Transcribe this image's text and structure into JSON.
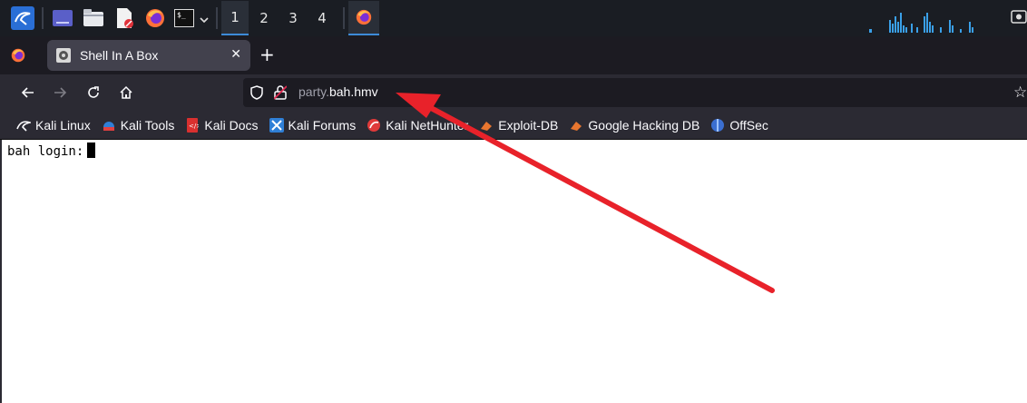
{
  "taskbar": {
    "workspaces": [
      "1",
      "2",
      "3",
      "4"
    ],
    "active_workspace": "1",
    "accent_color": "#3d8bd8"
  },
  "browser": {
    "tab": {
      "title": "Shell In A Box",
      "close_glyph": "✕",
      "favicon": "shellinabox-icon"
    },
    "new_tab_glyph": "+",
    "url": {
      "subdomain": "party.",
      "domain": "bah.hmv"
    },
    "bookmarks": [
      {
        "label": "Kali Linux",
        "icon": "kali-dragon-icon"
      },
      {
        "label": "Kali Tools",
        "icon": "kali-tools-icon"
      },
      {
        "label": "Kali Docs",
        "icon": "kali-docs-icon"
      },
      {
        "label": "Kali Forums",
        "icon": "kali-forums-icon"
      },
      {
        "label": "Kali NetHunter",
        "icon": "kali-nethunter-icon"
      },
      {
        "label": "Exploit-DB",
        "icon": "exploit-db-icon"
      },
      {
        "label": "Google Hacking DB",
        "icon": "ghdb-icon"
      },
      {
        "label": "OffSec",
        "icon": "offsec-icon"
      }
    ]
  },
  "terminal": {
    "prompt": "bah login:"
  },
  "annotation": {
    "arrow_color": "#e8222a"
  }
}
